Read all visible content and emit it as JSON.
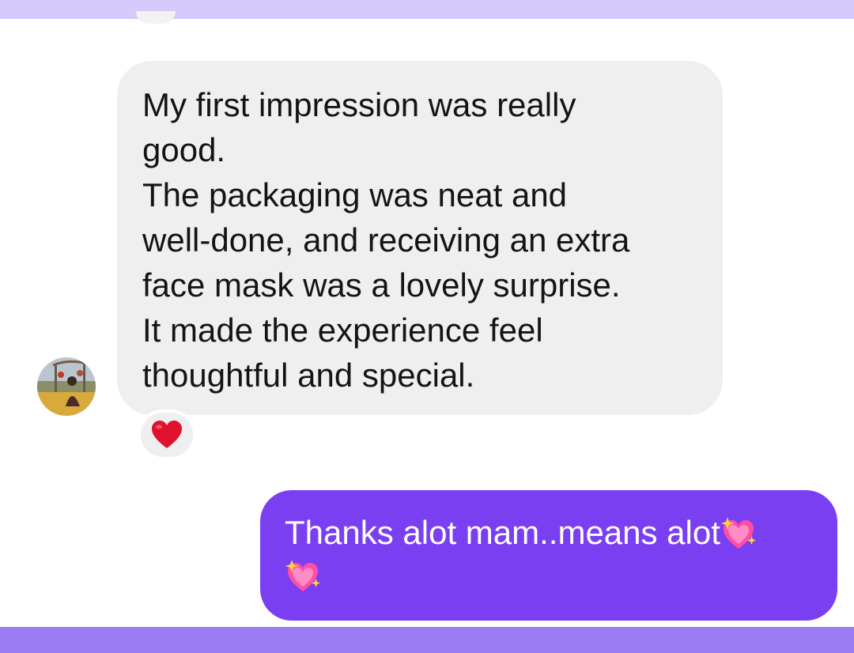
{
  "conversation": {
    "incoming": {
      "lines": [
        "My first impression was really",
        "good.",
        "The packaging was neat and",
        "well-done, and receiving an extra",
        "face mask was a lovely surprise.",
        "It made the experience feel",
        "thoughtful and special."
      ],
      "reaction": "heart-icon"
    },
    "outgoing": {
      "text": "Thanks alot mam..means alot",
      "emoji": "sparkling-heart-icon"
    }
  },
  "colors": {
    "incoming_bubble": "#efefef",
    "outgoing_bubble": "#7b3ff2",
    "top_band": "#d6c9fb",
    "bottom_band": "#9b7cf2",
    "reaction_heart": "#e0112c"
  }
}
